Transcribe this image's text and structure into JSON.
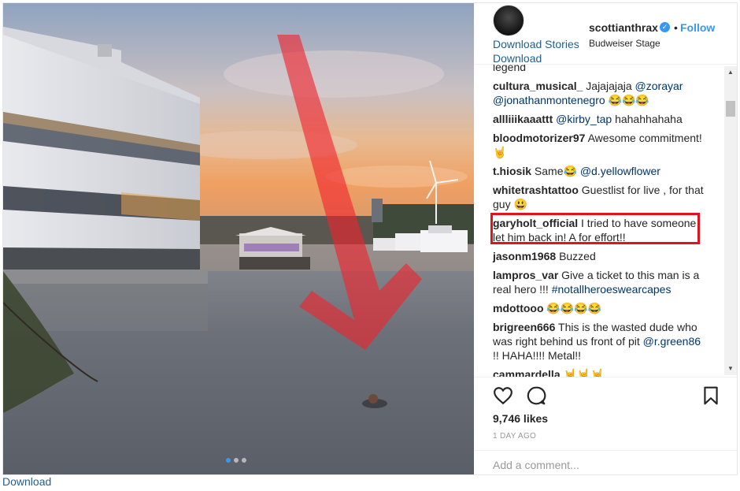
{
  "header": {
    "username": "scottianthrax",
    "separator": "•",
    "follow_label": "Follow",
    "location": "Budweiser Stage",
    "download_stories": "Download Stories",
    "download": "Download"
  },
  "photo": {
    "carousel_dots": 3,
    "active_dot": 1
  },
  "comments": [
    {
      "user": "",
      "text": "legend"
    },
    {
      "user": "cultura_musical_",
      "text": "Jajajajaja ",
      "mention": "@zorayar @jonathanmontenegro",
      "suffix": " 😂😂😂"
    },
    {
      "user": "allliiikaaattt",
      "text": "",
      "mention": "@kirby_tap",
      "suffix": " hahahhahaha"
    },
    {
      "user": "bloodmotorizer97",
      "text": "Awesome commitment! 🤘",
      "mention": "",
      "suffix": ""
    },
    {
      "user": "t.hiosik",
      "text": "Same😂 ",
      "mention": "@d.yellowflower",
      "suffix": ""
    },
    {
      "user": "whitetrashtattoo",
      "text": "Guestlist for live , for that guy 😃",
      "mention": "",
      "suffix": ""
    },
    {
      "user": "garyholt_official",
      "text": "I tried to have someone let him back in! A for effort!!",
      "mention": "",
      "suffix": ""
    },
    {
      "user": "jasonm1968",
      "text": "Buzzed",
      "mention": "",
      "suffix": ""
    },
    {
      "user": "lampros_var",
      "text": "Give a ticket to this man is a real hero !!! ",
      "mention": "#notallheroeswearcapes",
      "suffix": ""
    },
    {
      "user": "mdottooo",
      "text": "😂😂😂😂",
      "mention": "",
      "suffix": ""
    },
    {
      "user": "brigreen666",
      "text": "This is the wasted dude who was right behind us front of pit ",
      "mention": "@r.green86",
      "suffix": " !! HAHA!!!! Metal!!"
    },
    {
      "user": "cammardella",
      "text": "🤘🤘🤘",
      "mention": "",
      "suffix": ""
    }
  ],
  "actions": {
    "likes": "9,746 likes",
    "time": "1 DAY AGO",
    "comment_placeholder": "Add a comment..."
  },
  "bottom": {
    "download": "Download"
  },
  "colors": {
    "accent": "#3897f0",
    "highlight": "#e0141e",
    "link": "#1f5f8f"
  },
  "icons": [
    "heart-icon",
    "comment-icon",
    "bookmark-icon",
    "verified-icon"
  ]
}
